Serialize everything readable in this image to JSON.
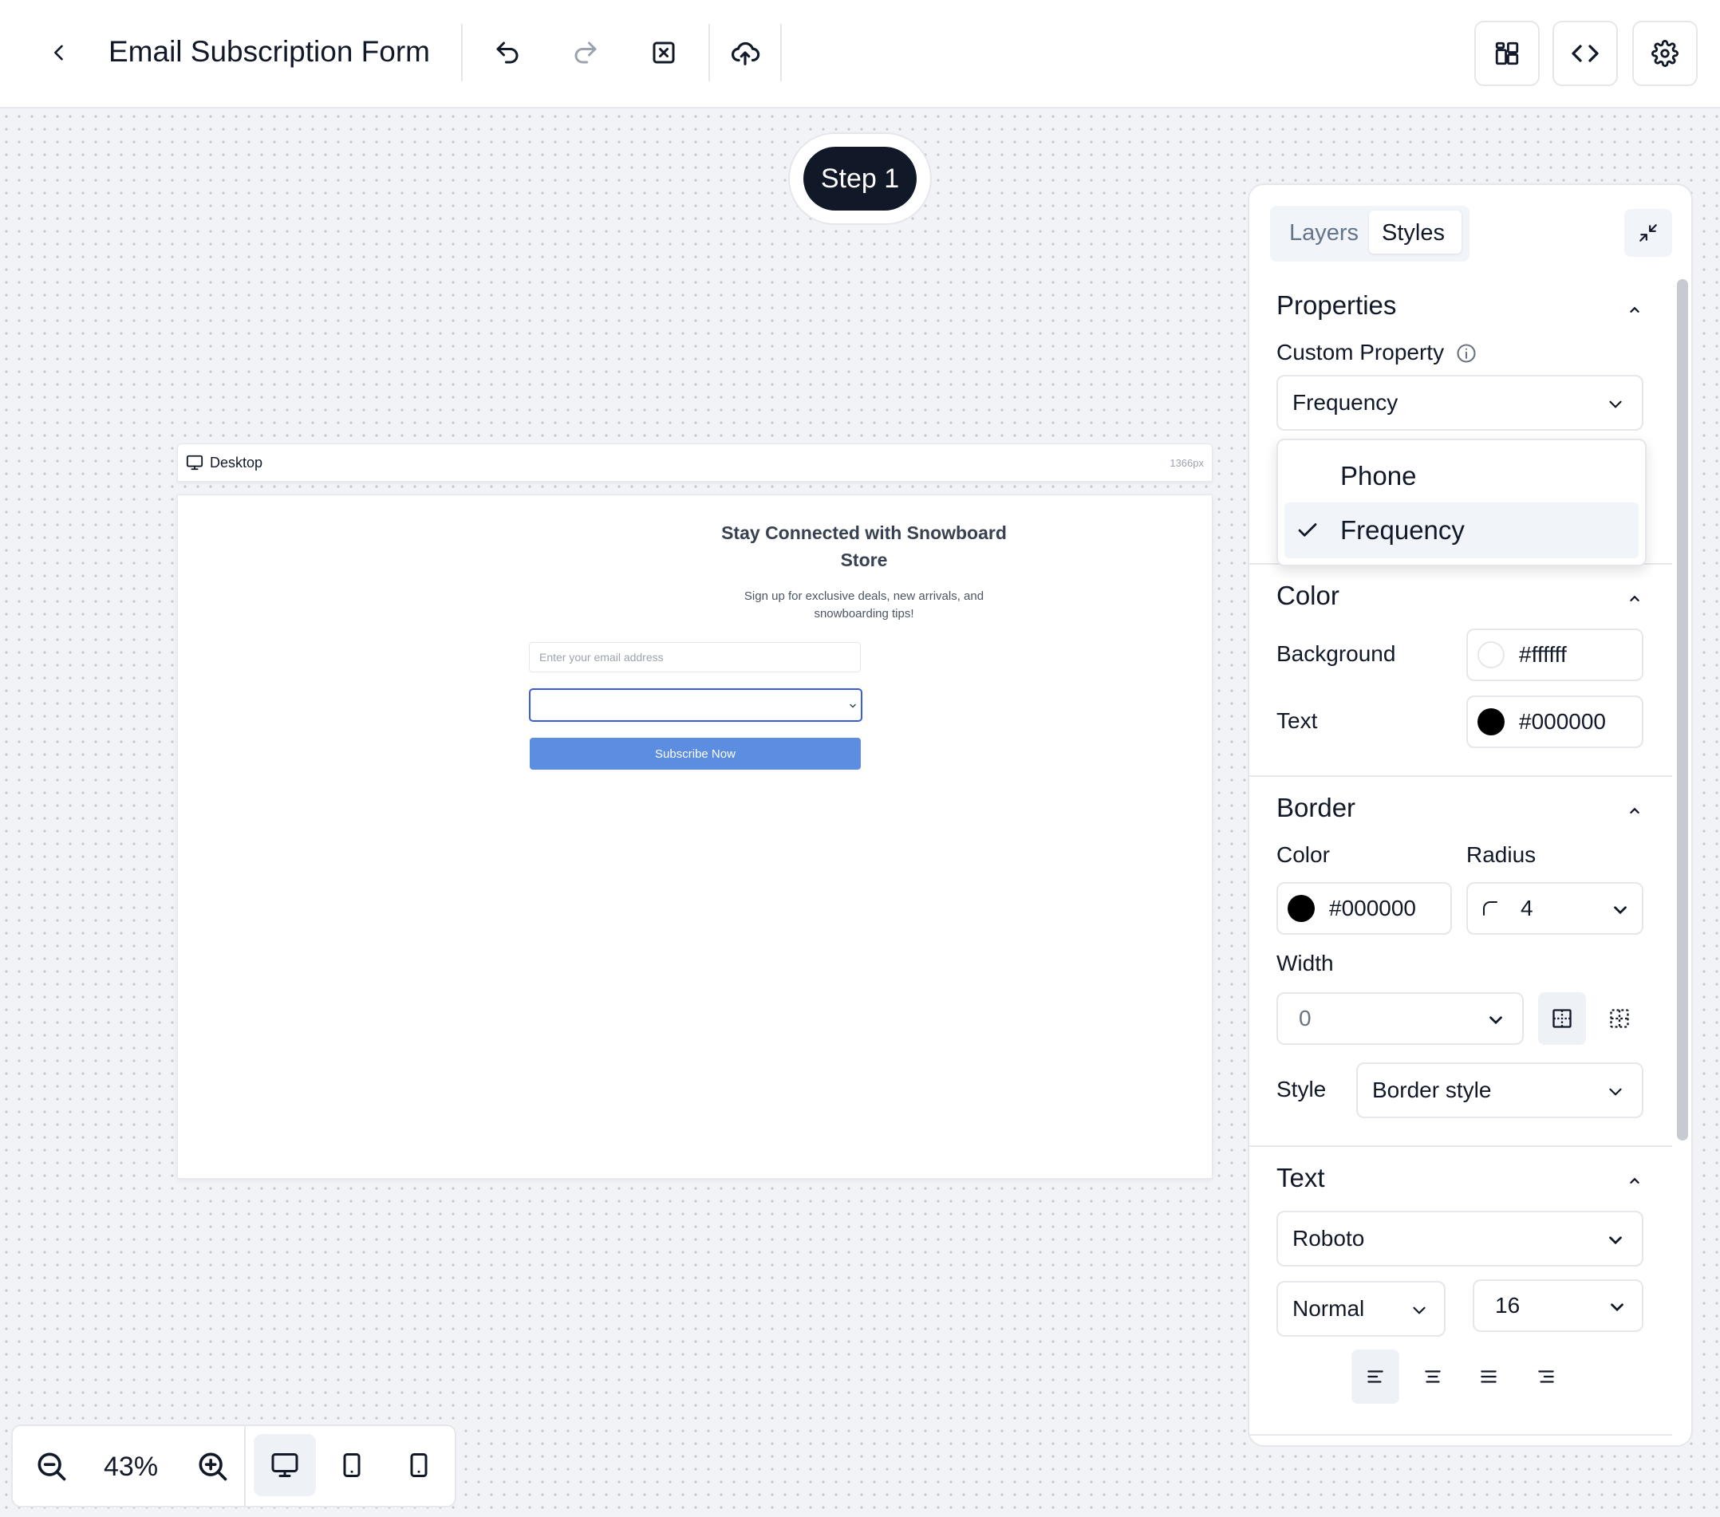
{
  "header": {
    "title": "Email Subscription Form"
  },
  "canvas": {
    "step_label": "Step 1",
    "frame": {
      "device_label": "Desktop",
      "width_label": "1366px"
    },
    "form": {
      "title": "Stay Connected with Snowboard Store",
      "subtitle": "Sign up for exclusive deals, new arrivals, and snowboarding tips!",
      "email_placeholder": "Enter your email address",
      "select_value": "",
      "button_label": "Subscribe Now"
    }
  },
  "zoom": {
    "level": "43%"
  },
  "panel": {
    "tabs": [
      {
        "label": "Layers",
        "active": false
      },
      {
        "label": "Styles",
        "active": true
      }
    ],
    "properties": {
      "heading": "Properties",
      "custom_property_label": "Custom Property",
      "custom_property_value": "Frequency",
      "dropdown_options": [
        {
          "label": "Phone",
          "selected": false
        },
        {
          "label": "Frequency",
          "selected": true
        }
      ]
    },
    "color": {
      "heading": "Color",
      "background_label": "Background",
      "background_value": "#ffffff",
      "text_label": "Text",
      "text_value": "#000000"
    },
    "border": {
      "heading": "Border",
      "color_label": "Color",
      "color_value": "#000000",
      "radius_label": "Radius",
      "radius_value": "4",
      "width_label": "Width",
      "width_value": "0",
      "style_label": "Style",
      "style_value": "Border style"
    },
    "text": {
      "heading": "Text",
      "font": "Roboto",
      "weight": "Normal",
      "size": "16"
    }
  },
  "colors": {
    "accent_dark": "#111827",
    "subscribe_button": "#5b8de0",
    "select_focus": "#3b5bdb"
  }
}
